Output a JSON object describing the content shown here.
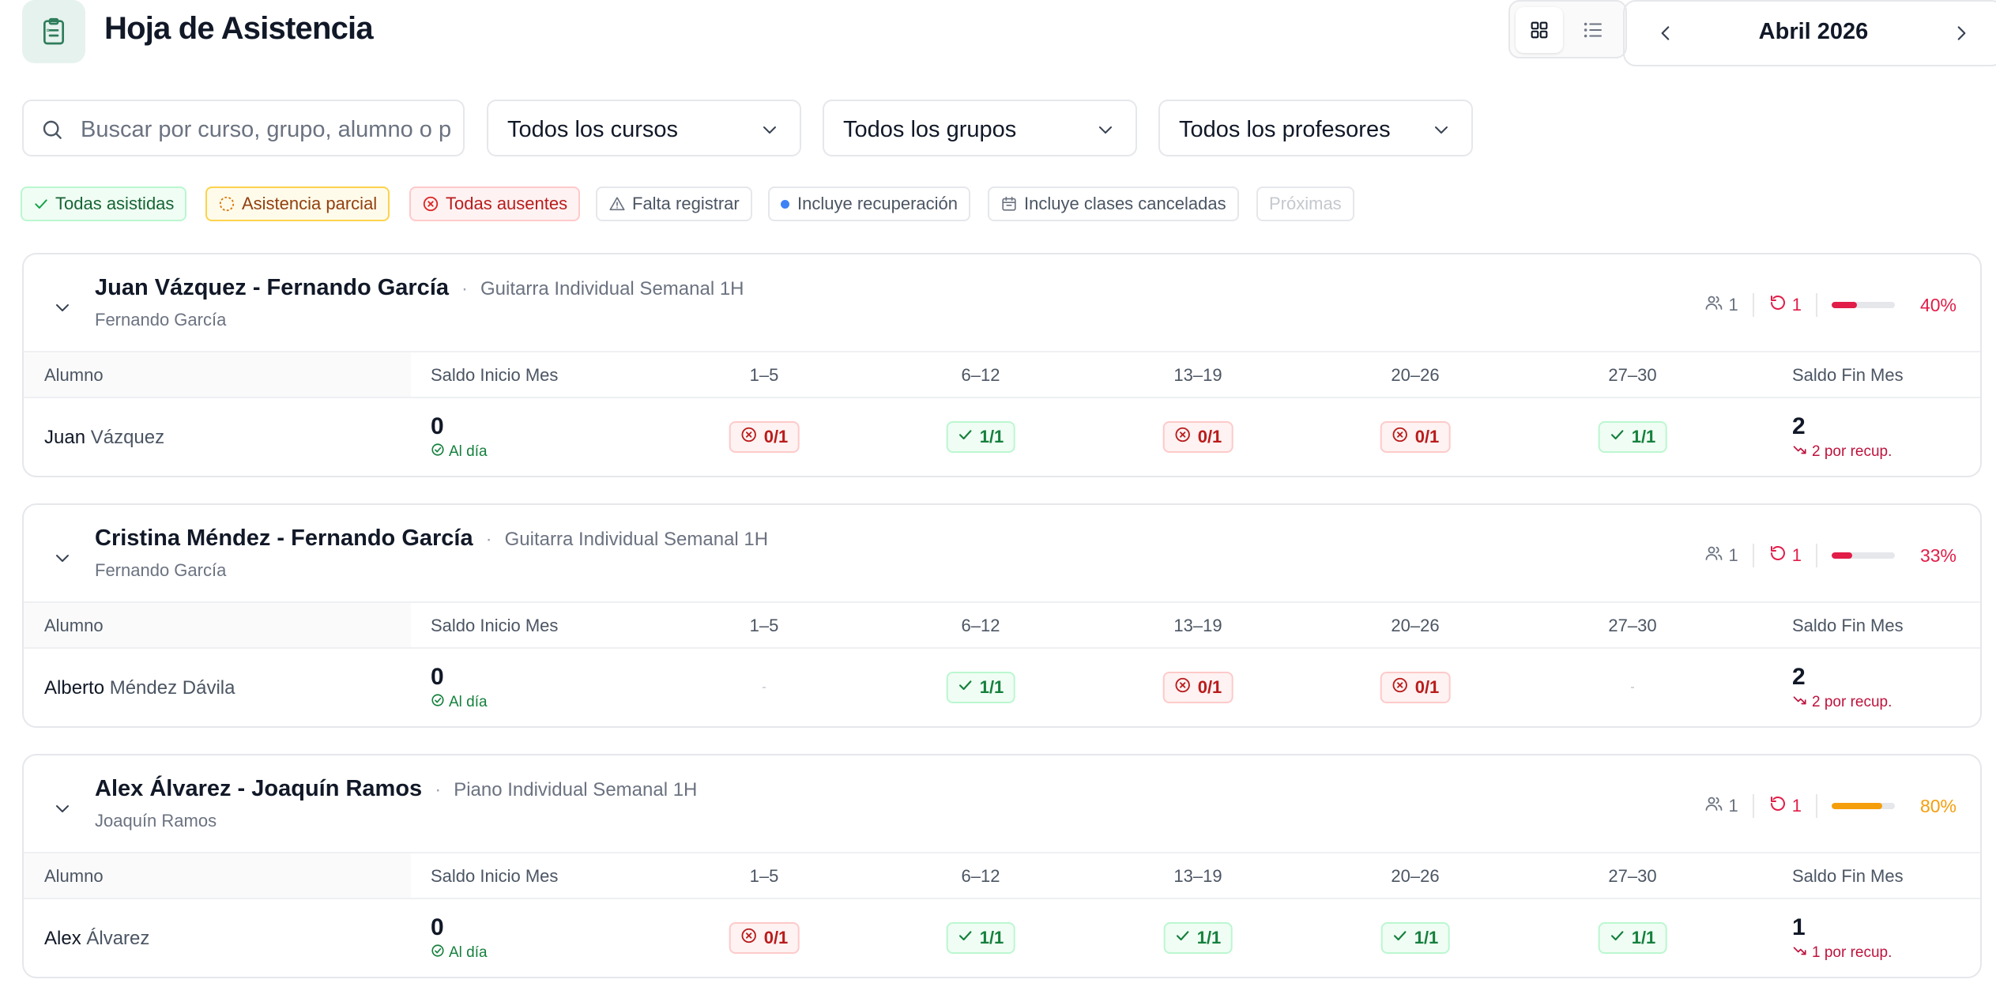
{
  "header": {
    "title": "Hoja de Asistencia",
    "month": "Abril 2026"
  },
  "filters": {
    "search_placeholder": "Buscar por curso, grupo, alumno o p",
    "course": "Todos los cursos",
    "group": "Todos los grupos",
    "teacher": "Todos los profesores"
  },
  "legend": {
    "all_attended": "Todas asistidas",
    "partial": "Asistencia parcial",
    "all_absent": "Todas ausentes",
    "missing": "Falta registrar",
    "recovery": "Incluye recuperación",
    "cancelled": "Incluye clases canceladas",
    "upcoming": "Próximas"
  },
  "columns": {
    "student": "Alumno",
    "start_balance": "Saldo Inicio Mes",
    "weeks": [
      "1–5",
      "6–12",
      "13–19",
      "20–26",
      "27–30"
    ],
    "end_balance": "Saldo Fin Mes"
  },
  "groups": [
    {
      "name": "Juan Vázquez - Fernando García",
      "course": "Guitarra Individual Semanal 1H",
      "teacher": "Fernando García",
      "students_count": "1",
      "recovery_count": "1",
      "percent": "40%",
      "percent_value": 40,
      "percent_color": "#e11d48",
      "student_first": "Juan",
      "student_last": " Vázquez",
      "start_balance": "0",
      "start_status": "Al día",
      "weeks": [
        {
          "text": "0/1",
          "state": "miss"
        },
        {
          "text": "1/1",
          "state": "ok"
        },
        {
          "text": "0/1",
          "state": "miss"
        },
        {
          "text": "0/1",
          "state": "miss"
        },
        {
          "text": "1/1",
          "state": "ok"
        }
      ],
      "end_balance": "2",
      "end_status": "2 por recup."
    },
    {
      "name": "Cristina Méndez - Fernando García",
      "course": "Guitarra Individual Semanal 1H",
      "teacher": "Fernando García",
      "students_count": "1",
      "recovery_count": "1",
      "percent": "33%",
      "percent_value": 33,
      "percent_color": "#e11d48",
      "student_first": "Alberto",
      "student_last": " Méndez Dávila",
      "start_balance": "0",
      "start_status": "Al día",
      "weeks": [
        {
          "text": "",
          "state": "empty"
        },
        {
          "text": "1/1",
          "state": "ok"
        },
        {
          "text": "0/1",
          "state": "miss"
        },
        {
          "text": "0/1",
          "state": "miss"
        },
        {
          "text": "",
          "state": "empty"
        }
      ],
      "end_balance": "2",
      "end_status": "2 por recup."
    },
    {
      "name": "Alex Álvarez - Joaquín Ramos",
      "course": "Piano Individual Semanal 1H",
      "teacher": "Joaquín Ramos",
      "students_count": "1",
      "recovery_count": "1",
      "percent": "80%",
      "percent_value": 80,
      "percent_color": "#f59e0b",
      "student_first": "Alex",
      "student_last": " Álvarez",
      "start_balance": "0",
      "start_status": "Al día",
      "weeks": [
        {
          "text": "0/1",
          "state": "miss"
        },
        {
          "text": "1/1",
          "state": "ok"
        },
        {
          "text": "1/1",
          "state": "ok"
        },
        {
          "text": "1/1",
          "state": "ok"
        },
        {
          "text": "1/1",
          "state": "ok"
        }
      ],
      "end_balance": "1",
      "end_status": "1 por recup."
    }
  ]
}
